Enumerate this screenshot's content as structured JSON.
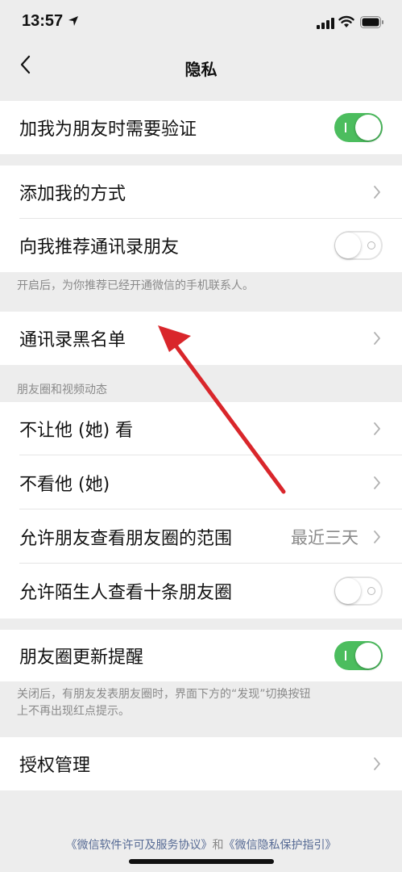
{
  "status": {
    "time": "13:57"
  },
  "nav": {
    "title": "隐私"
  },
  "rows": {
    "verify": {
      "label": "加我为朋友时需要验证",
      "toggle": "on"
    },
    "add_methods": {
      "label": "添加我的方式"
    },
    "recommend_contacts": {
      "label": "向我推荐通讯录朋友",
      "toggle": "off"
    },
    "recommend_hint": "开启后，为你推荐已经开通微信的手机联系人。",
    "blacklist": {
      "label": "通讯录黑名单"
    },
    "moments_section": "朋友圈和视频动态",
    "hide_my_posts": {
      "label": "不让他 (她) 看"
    },
    "hide_their_posts": {
      "label": "不看他 (她)"
    },
    "moments_range": {
      "label": "允许朋友查看朋友圈的范围",
      "value": "最近三天"
    },
    "stranger_ten": {
      "label": "允许陌生人查看十条朋友圈",
      "toggle": "off"
    },
    "moments_update": {
      "label": "朋友圈更新提醒",
      "toggle": "on"
    },
    "moments_update_hint_1": "关闭后，有朋友发表朋友圈时，界面下方的“发现”切换按钮",
    "moments_update_hint_2": "上不再出现红点提示。",
    "authorization": {
      "label": "授权管理"
    }
  },
  "footer": {
    "license_link": "《微信软件许可及服务协议》",
    "and": "和",
    "privacy_link": "《微信隐私保护指引》"
  },
  "colors": {
    "toggle_on": "#4cbd5e",
    "link": "#576b95",
    "arrow": "#d9262b",
    "background": "#ededed"
  }
}
